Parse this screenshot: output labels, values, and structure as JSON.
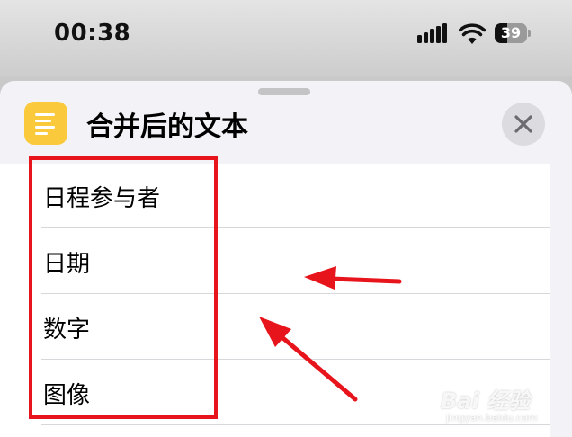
{
  "status_bar": {
    "time": "00:38",
    "battery_level": "39",
    "icons": [
      "cellular-signal-icon",
      "wifi-icon",
      "battery-icon"
    ]
  },
  "sheet": {
    "title": "合并后的文本",
    "app_icon": "text-lines-icon",
    "close_icon": "close-icon"
  },
  "list": {
    "items": [
      {
        "label": "日程参与者"
      },
      {
        "label": "日期"
      },
      {
        "label": "数字"
      },
      {
        "label": "图像"
      }
    ]
  },
  "annotation": {
    "box_color": "#e8141c",
    "arrow_color": "#e8141c"
  },
  "watermark": {
    "main": "Bai 经验",
    "sub": "jingyan.baidu.com"
  },
  "colors": {
    "app_icon_bg": "#fbc93c",
    "sheet_bg": "#f2f2f7"
  }
}
